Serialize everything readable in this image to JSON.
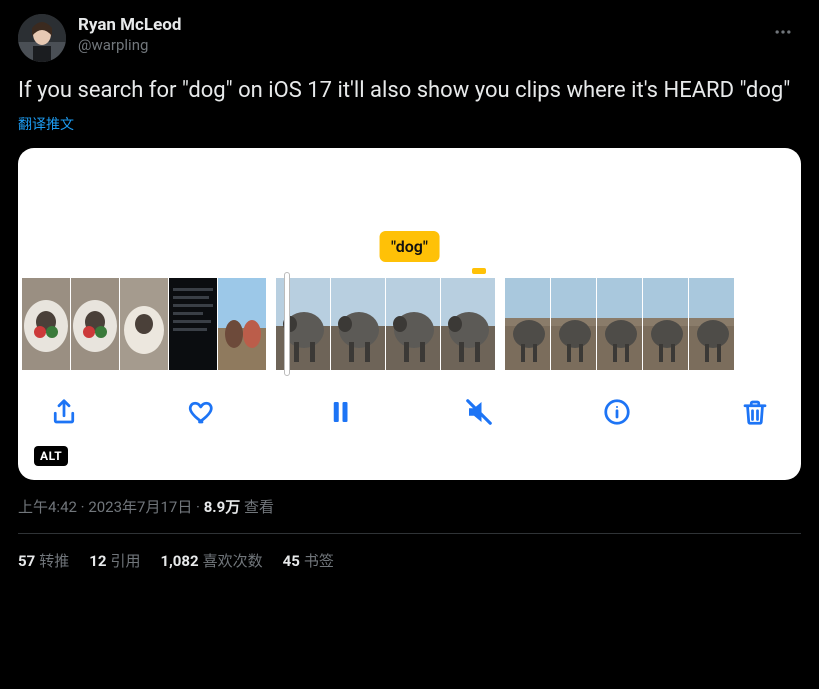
{
  "author": {
    "display_name": "Ryan McLeod",
    "handle": "@warpling"
  },
  "body_text": "If you search for \"dog\" on iOS 17 it'll also show you clips where it's HEARD \"dog\"",
  "translate_label": "翻译推文",
  "media": {
    "callout_text": "\"dog\"",
    "alt_badge": "ALT"
  },
  "meta": {
    "time": "上午4:42",
    "date": "2023年7月17日",
    "separator": " · ",
    "views_count": "8.9万",
    "views_label": " 查看"
  },
  "stats": {
    "retweets": {
      "count": "57",
      "label": "转推"
    },
    "quotes": {
      "count": "12",
      "label": "引用"
    },
    "likes": {
      "count": "1,082",
      "label": "喜欢次数"
    },
    "bookmarks": {
      "count": "45",
      "label": "书签"
    }
  }
}
